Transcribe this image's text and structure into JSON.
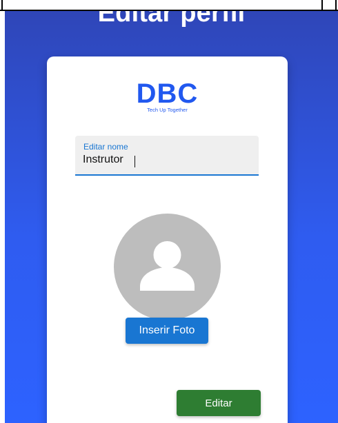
{
  "page": {
    "title": "Editar perfil"
  },
  "logo": {
    "mark": "DBC",
    "tagline": "Tech Up Together"
  },
  "name_field": {
    "label": "Editar nome",
    "value": "Instrutor"
  },
  "avatar": {
    "icon": "person-icon"
  },
  "buttons": {
    "insert_photo": "Inserir Foto",
    "edit": "Editar"
  },
  "colors": {
    "background_top": "#2f46b8",
    "background_bottom": "#2d62ff",
    "brand_blue": "#2158ef",
    "primary_button": "#1976d2",
    "success_button": "#2e7d32",
    "avatar_gray": "#bdbdbd"
  }
}
